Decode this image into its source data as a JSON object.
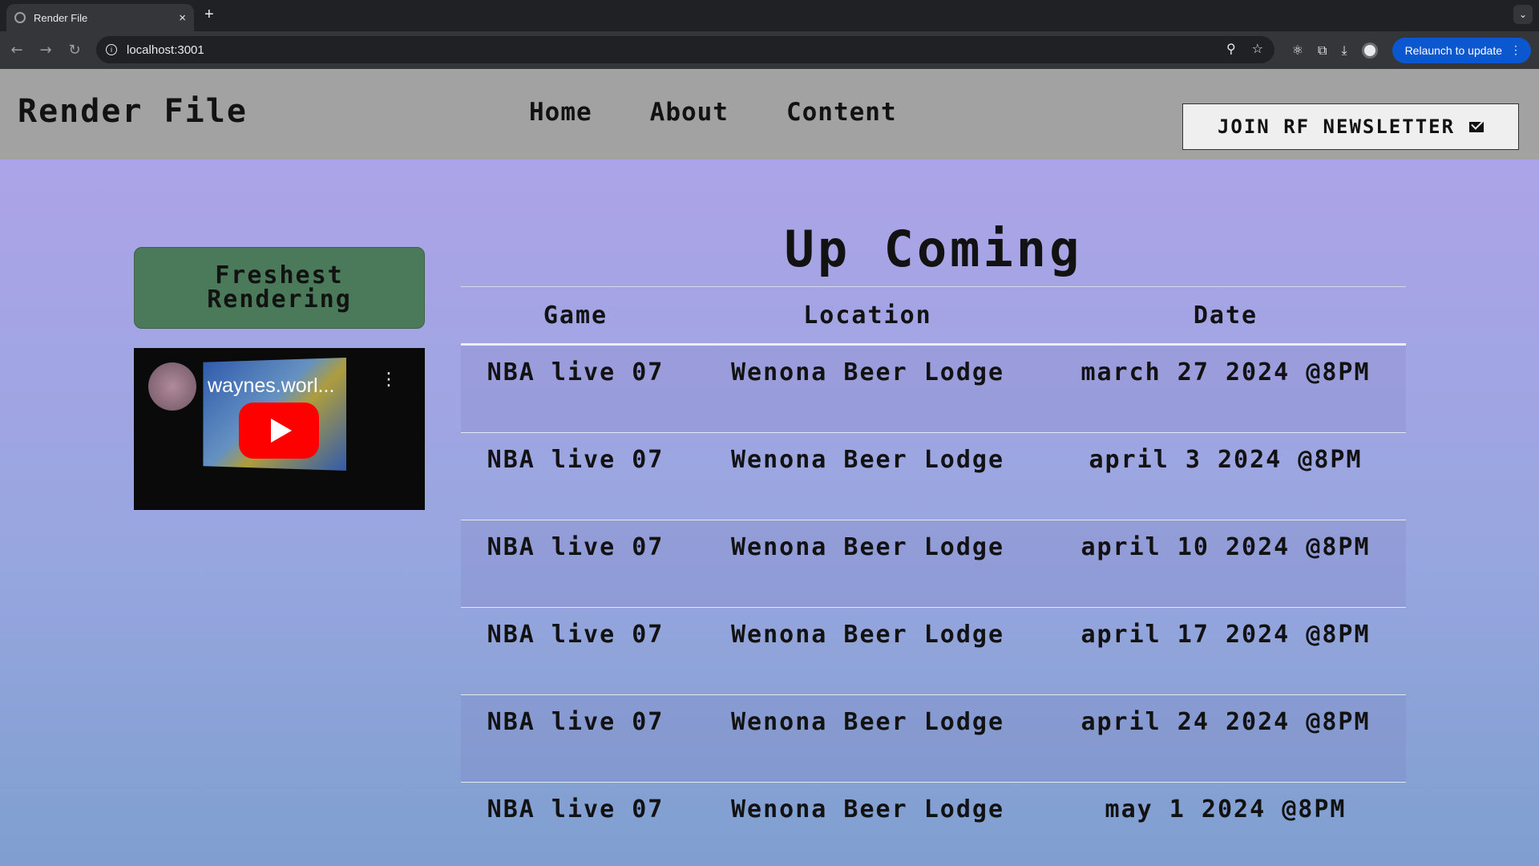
{
  "browser": {
    "tab_title": "Render File",
    "tab_close": "×",
    "new_tab": "+",
    "url": "localhost:3001",
    "relaunch_label": "Relaunch to update",
    "tab_menu": "⌄"
  },
  "site": {
    "brand": "Render File",
    "nav": [
      {
        "label": "Home"
      },
      {
        "label": "About"
      },
      {
        "label": "Content"
      }
    ],
    "newsletter_label": "JOIN RF NEWSLETTER",
    "freshest_label": "Freshest Rendering",
    "video": {
      "title": "waynes.worl..."
    },
    "heading": "Up Coming",
    "table": {
      "headers": [
        "Game",
        "Location",
        "Date"
      ],
      "rows": [
        {
          "game": "NBA live 07",
          "location": "Wenona Beer Lodge",
          "date": "march 27 2024 @8PM"
        },
        {
          "game": "NBA live 07",
          "location": "Wenona Beer Lodge",
          "date": "april 3 2024 @8PM"
        },
        {
          "game": "NBA live 07",
          "location": "Wenona Beer Lodge",
          "date": "april 10 2024 @8PM"
        },
        {
          "game": "NBA live 07",
          "location": "Wenona Beer Lodge",
          "date": "april 17 2024 @8PM"
        },
        {
          "game": "NBA live 07",
          "location": "Wenona Beer Lodge",
          "date": "april 24 2024 @8PM"
        },
        {
          "game": "NBA live 07",
          "location": "Wenona Beer Lodge",
          "date": "may 1 2024 @8PM"
        }
      ]
    }
  },
  "colors": {
    "header_bg": "#a3a2a2",
    "page_gradient_top": "#b1a3ea",
    "page_gradient_bottom": "#7f9fd0",
    "freshest_bg": "#4a7a59",
    "relaunch_bg": "#0b57d0"
  }
}
